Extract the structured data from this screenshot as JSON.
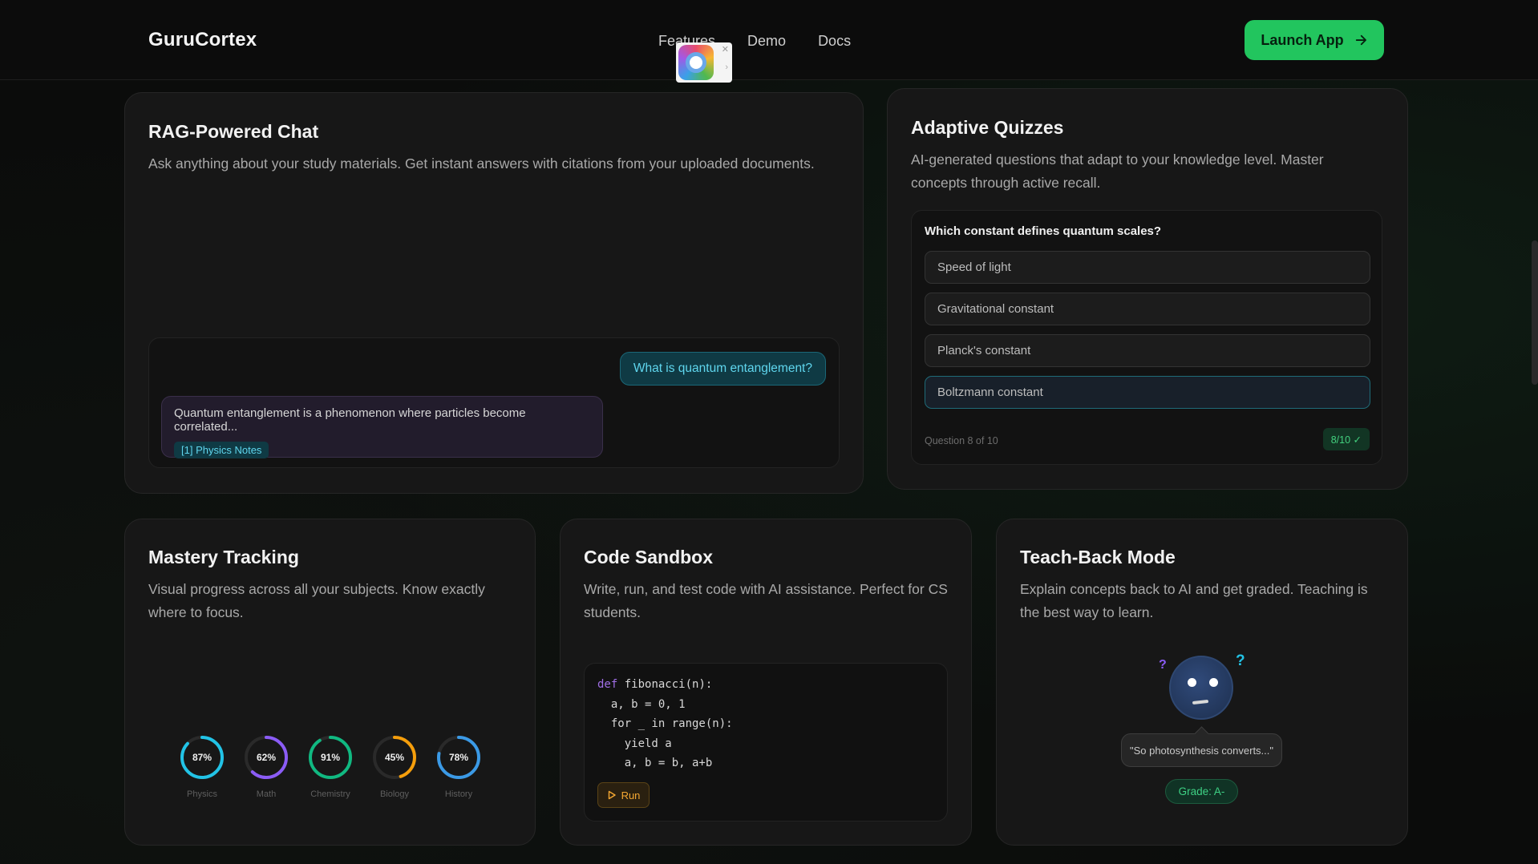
{
  "nav": {
    "brand": "GuruCortex",
    "links": [
      "Features",
      "Demo",
      "Docs"
    ],
    "cta": "Launch App"
  },
  "cards": {
    "rag": {
      "title": "RAG-Powered Chat",
      "desc": "Ask anything about your study materials. Get instant answers with citations from your uploaded documents.",
      "user_msg": "What is quantum entanglement?",
      "bot_msg": "Quantum entanglement is a phenomenon where particles become correlated...",
      "citation": "[1] Physics Notes"
    },
    "quiz": {
      "title": "Adaptive Quizzes",
      "desc": "AI-generated questions that adapt to your knowledge level. Master concepts through active recall.",
      "question": "Which constant defines quantum scales?",
      "options": [
        "Speed of light",
        "Gravitational constant",
        "Planck's constant",
        "Boltzmann constant"
      ],
      "selected_index": 3,
      "progress": "Question 8 of 10",
      "score": "8/10 ✓"
    },
    "mastery": {
      "title": "Mastery Tracking",
      "desc": "Visual progress across all your subjects. Know exactly where to focus.",
      "subjects": [
        {
          "name": "Physics",
          "pct": "87%",
          "value": 0.87,
          "color": "#22c3e6"
        },
        {
          "name": "Math",
          "pct": "62%",
          "value": 0.62,
          "color": "#8b5cf6"
        },
        {
          "name": "Chemistry",
          "pct": "91%",
          "value": 0.91,
          "color": "#10b981"
        },
        {
          "name": "Biology",
          "pct": "45%",
          "value": 0.45,
          "color": "#f59e0b"
        },
        {
          "name": "History",
          "pct": "78%",
          "value": 0.78,
          "color": "#3b9ae6"
        }
      ]
    },
    "code": {
      "title": "Code Sandbox",
      "desc": "Write, run, and test code with AI assistance. Perfect for CS students.",
      "lines": [
        {
          "kw": "def",
          "text": " fibonacci(n):"
        },
        {
          "kw": "",
          "text": "  a, b = 0, 1"
        },
        {
          "kw": "",
          "text": "  for _ in range(n):"
        },
        {
          "kw": "",
          "text": "    yield a"
        },
        {
          "kw": "",
          "text": "    a, b = b, a+b"
        }
      ],
      "run_label": "Run"
    },
    "teach": {
      "title": "Teach-Back Mode",
      "desc": "Explain concepts back to AI and get graded. Teaching is the best way to learn.",
      "speech": "\"So photosynthesis converts...\"",
      "grade": "Grade: A-",
      "qmarks": [
        "?",
        "?"
      ]
    }
  },
  "colors": {
    "accent": "#22c55e",
    "cyan": "#5fd6ee",
    "background": "#0b0c0b"
  }
}
